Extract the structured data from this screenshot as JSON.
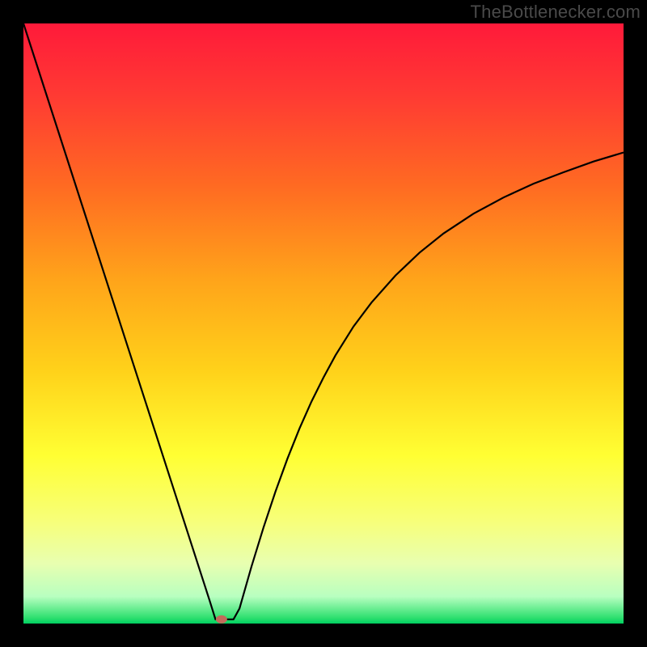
{
  "watermark": "TheBottlenecker.com",
  "chart_data": {
    "type": "line",
    "title": "",
    "xlabel": "",
    "ylabel": "",
    "xlim": [
      0,
      100
    ],
    "ylim": [
      0,
      100
    ],
    "x": [
      0,
      2,
      4,
      6,
      8,
      10,
      12,
      14,
      16,
      18,
      20,
      22,
      24,
      26,
      28,
      30,
      31,
      32,
      33,
      34,
      35,
      36,
      38,
      40,
      42,
      44,
      46,
      48,
      50,
      52,
      55,
      58,
      62,
      66,
      70,
      75,
      80,
      85,
      90,
      95,
      100
    ],
    "values": [
      100,
      93.8,
      87.6,
      81.4,
      75.2,
      69,
      62.8,
      56.6,
      50.4,
      44.2,
      38,
      31.8,
      25.6,
      19.4,
      13.2,
      7,
      3.9,
      0.7,
      0.7,
      0.7,
      0.7,
      2.5,
      9.5,
      16,
      22,
      27.5,
      32.5,
      37,
      41,
      44.7,
      49.5,
      53.5,
      58,
      61.8,
      65,
      68.3,
      71,
      73.3,
      75.2,
      77,
      78.5
    ],
    "min_marker": {
      "x": 33,
      "y": 0.7
    },
    "annotations": [],
    "gradient_stops": [
      {
        "offset": 0,
        "color": "#ff1a3a"
      },
      {
        "offset": 0.12,
        "color": "#ff3a33"
      },
      {
        "offset": 0.27,
        "color": "#ff6a22"
      },
      {
        "offset": 0.43,
        "color": "#ffa51a"
      },
      {
        "offset": 0.58,
        "color": "#ffd21a"
      },
      {
        "offset": 0.72,
        "color": "#ffff33"
      },
      {
        "offset": 0.83,
        "color": "#f7ff7a"
      },
      {
        "offset": 0.9,
        "color": "#e8ffb0"
      },
      {
        "offset": 0.955,
        "color": "#b8ffc0"
      },
      {
        "offset": 0.99,
        "color": "#30e070"
      },
      {
        "offset": 1.0,
        "color": "#00d060"
      }
    ]
  }
}
